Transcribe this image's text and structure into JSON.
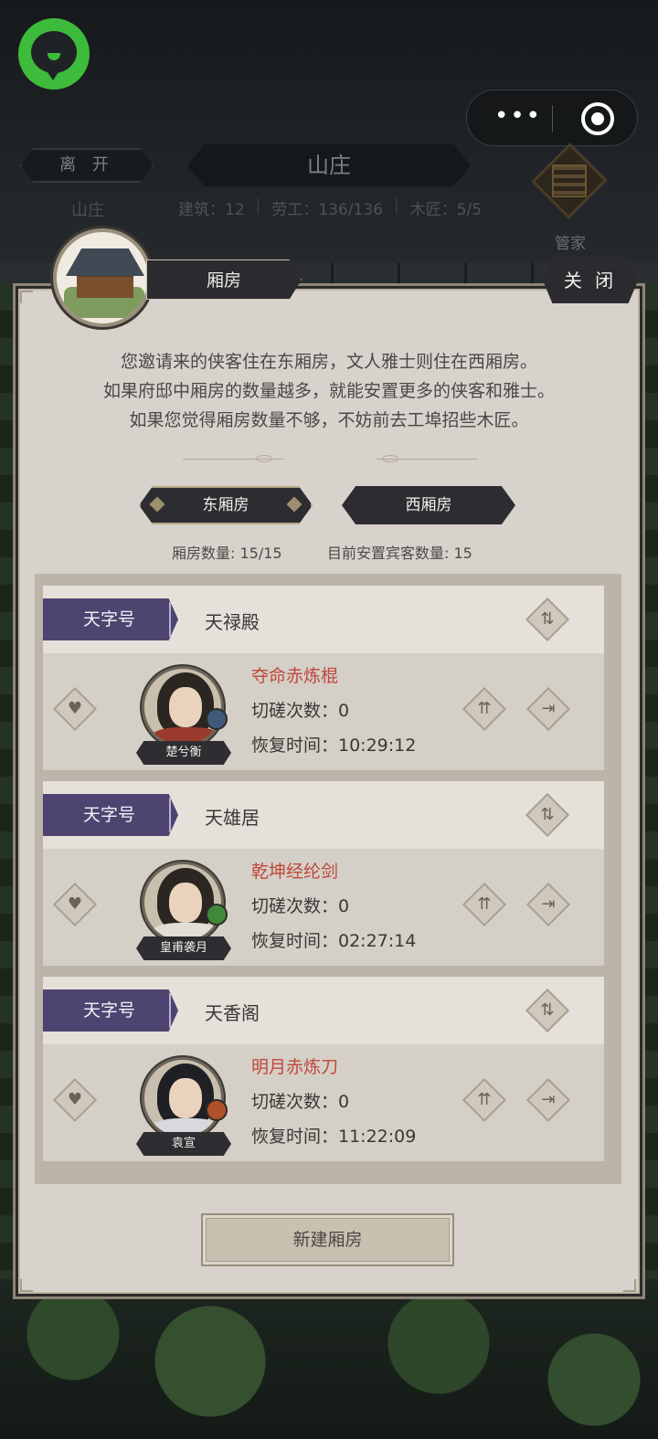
{
  "header": {
    "leave_label": "离 开",
    "title": "山庄",
    "left_sub": "山庄",
    "stats": {
      "buildings": "建筑：12",
      "labor": "劳工：136/136",
      "carpenter": "木匠：5/5"
    },
    "steward_label": "管家"
  },
  "panel": {
    "title": "厢房",
    "close_label": "关 闭",
    "intro": [
      "您邀请来的侠客住在东厢房，文人雅士则住在西厢房。",
      "如果府邸中厢房的数量越多，就能安置更多的侠客和雅士。",
      "如果您觉得厢房数量不够，不妨前去工埠招些木匠。"
    ],
    "tabs": {
      "east": "东厢房",
      "west": "西厢房"
    },
    "room_count": "厢房数量: 15/15",
    "guest_count": "目前安置宾客数量: 15",
    "build_button": "新建厢房"
  },
  "rooms": [
    {
      "grade": "天字号",
      "name": "天禄殿",
      "guest": "楚兮衡",
      "weapon": "夺命赤炼棍",
      "spar": "切磋次数：0",
      "recover": "恢复时间：10:29:12",
      "badge_color": "#3f5a78"
    },
    {
      "grade": "天字号",
      "name": "天雄居",
      "guest": "皇甫袭月",
      "weapon": "乾坤经纶剑",
      "spar": "切磋次数：0",
      "recover": "恢复时间：02:27:14",
      "badge_color": "#3f8a3a"
    },
    {
      "grade": "天字号",
      "name": "天香阁",
      "guest": "袁宣",
      "weapon": "明月赤炼刀",
      "spar": "切磋次数：0",
      "recover": "恢复时间：11:22:09",
      "badge_color": "#b0512a"
    }
  ],
  "icons": {
    "more": "more-icon",
    "target": "target-icon",
    "swap": "swap-icon",
    "heart": "heart-icon",
    "upgrade": "upgrade-icon",
    "exit": "exit-icon"
  },
  "colors": {
    "grade_purple": "#4e4470",
    "weapon_red": "#c0483a",
    "panel_bg": "#d7d2cb"
  }
}
